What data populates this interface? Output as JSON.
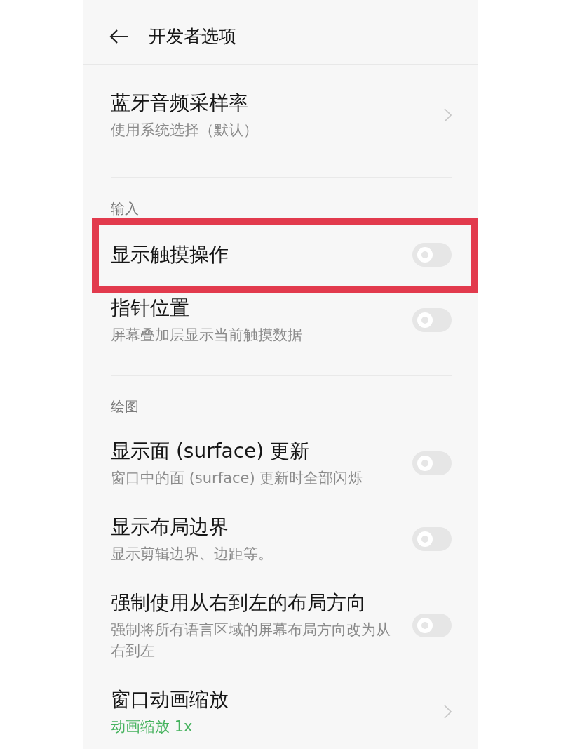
{
  "header": {
    "title": "开发者选项"
  },
  "sections": [
    {
      "items": [
        {
          "kind": "link",
          "title": "蓝牙音频采样率",
          "summary": "使用系统选择（默认）",
          "summary_accent": false,
          "highlighted": false
        }
      ]
    },
    {
      "heading": "输入",
      "items": [
        {
          "kind": "switch",
          "title": "显示触摸操作",
          "on": false,
          "highlighted": true
        },
        {
          "kind": "switch",
          "title": "指针位置",
          "summary": "屏幕叠加层显示当前触摸数据",
          "summary_accent": false,
          "on": false,
          "highlighted": false
        }
      ]
    },
    {
      "heading": "绘图",
      "items": [
        {
          "kind": "switch",
          "title": "显示面 (surface) 更新",
          "summary": "窗口中的面 (surface) 更新时全部闪烁",
          "summary_accent": false,
          "on": false,
          "highlighted": false
        },
        {
          "kind": "switch",
          "title": "显示布局边界",
          "summary": "显示剪辑边界、边距等。",
          "summary_accent": false,
          "on": false,
          "highlighted": false
        },
        {
          "kind": "switch",
          "title": "强制使用从右到左的布局方向",
          "summary": "强制将所有语言区域的屏幕布局方向改为从右到左",
          "summary_accent": false,
          "on": false,
          "highlighted": false
        },
        {
          "kind": "link",
          "title": "窗口动画缩放",
          "summary": "动画缩放 1x",
          "summary_accent": true,
          "highlighted": false
        }
      ]
    }
  ]
}
